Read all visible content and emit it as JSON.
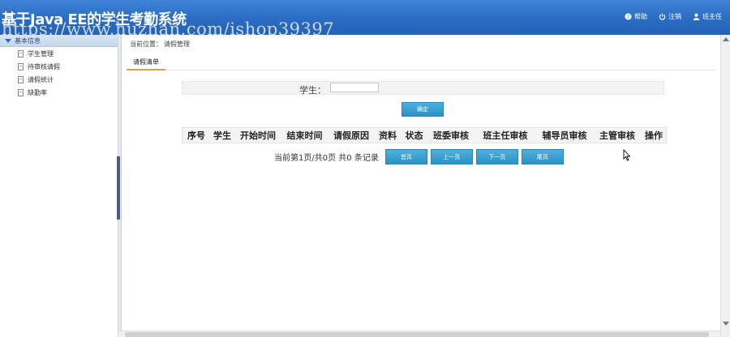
{
  "header": {
    "title": "基于Java EE的学生考勤系统",
    "watermark": "https://www.huzhan.com/ishop39397",
    "nav": [
      {
        "icon": "help-icon",
        "label": "帮助"
      },
      {
        "icon": "power-icon",
        "label": "注销"
      },
      {
        "icon": "user-icon",
        "label": "班主任"
      }
    ]
  },
  "sidebar": {
    "section_title": "基本信息",
    "items": [
      {
        "label": "学生管理"
      },
      {
        "label": "待审核请假"
      },
      {
        "label": "请假统计"
      },
      {
        "label": "缺勤率"
      }
    ]
  },
  "main": {
    "breadcrumb_prefix": "当前位置：",
    "breadcrumb_page": "请假管理",
    "tab_label": "请假清单",
    "search": {
      "label": "学生：",
      "value": ""
    },
    "confirm_label": "确定",
    "columns": [
      "序号",
      "学生",
      "开始时间",
      "结束时间",
      "请假原因",
      "资料",
      "状态",
      "班委审核",
      "班主任审核",
      "辅导员审核",
      "主管审核",
      "操作"
    ],
    "pager": {
      "text": "当前第1页/共0页  共0 条记录",
      "buttons": [
        "首页",
        "上一页",
        "下一页",
        "尾页"
      ]
    }
  }
}
